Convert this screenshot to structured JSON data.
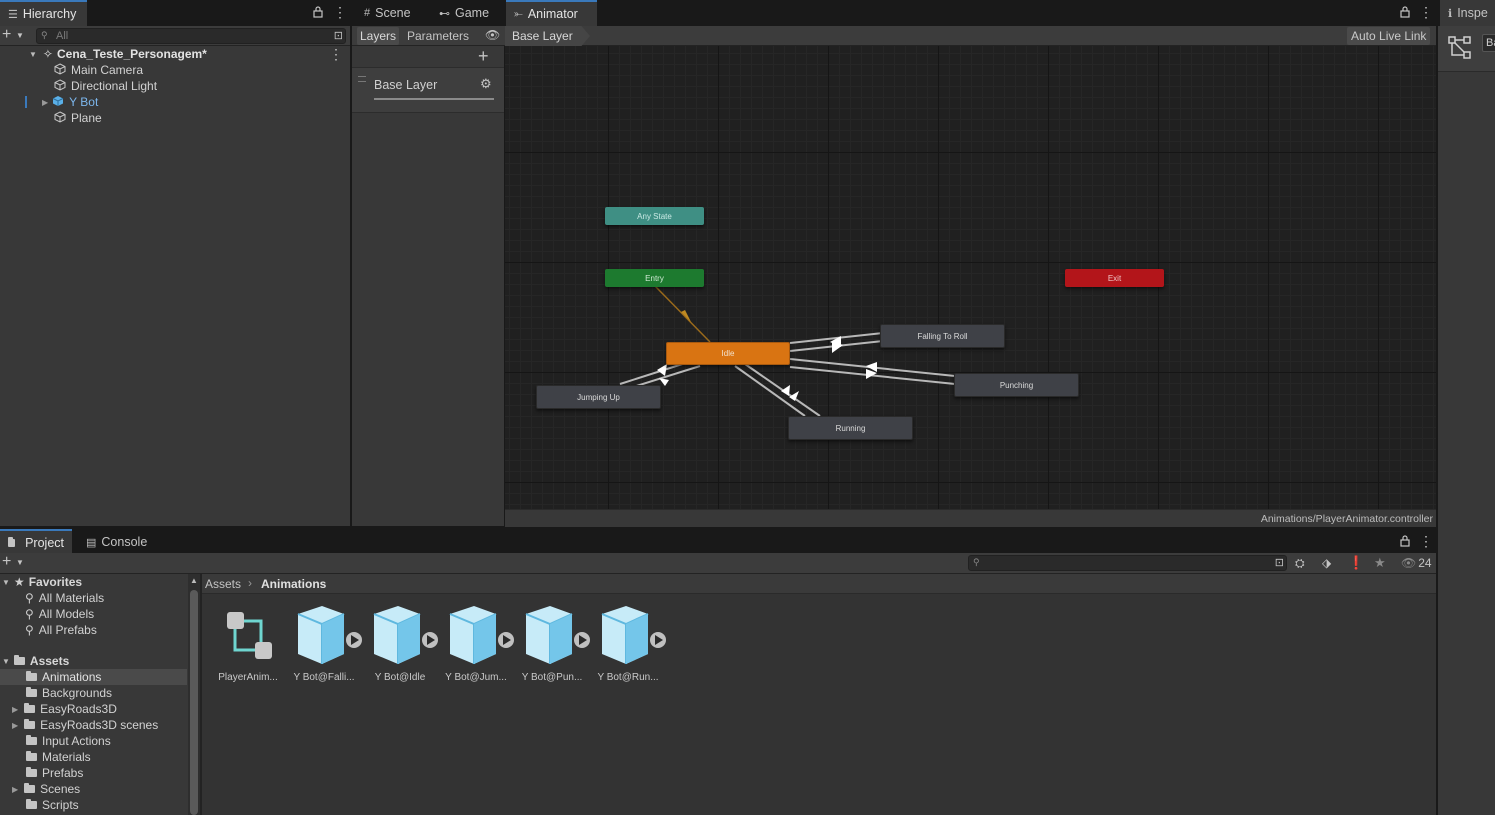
{
  "hierarchy": {
    "tab_label": "Hierarchy",
    "search_placeholder": "All",
    "scene_name": "Cena_Teste_Personagem*",
    "objects": [
      "Main Camera",
      "Directional Light",
      "Y Bot",
      "Plane"
    ]
  },
  "center_tabs": {
    "scene": "Scene",
    "game": "Game",
    "animator": "Animator"
  },
  "animator": {
    "layers_tab": "Layers",
    "parameters_tab": "Parameters",
    "breadcrumb": "Base Layer",
    "auto_live_link": "Auto Live Link",
    "layer_name": "Base Layer",
    "footer_path": "Animations/PlayerAnimator.controller",
    "states": {
      "any_state": "Any State",
      "entry": "Entry",
      "exit": "Exit",
      "idle": "Idle",
      "falling_to_roll": "Falling To Roll",
      "punching": "Punching",
      "jumping_up": "Jumping Up",
      "running": "Running"
    }
  },
  "inspector": {
    "tab_label": "Inspe",
    "field_value": "Ba"
  },
  "bottom_tabs": {
    "project": "Project",
    "console": "Console"
  },
  "project": {
    "favorites_label": "Favorites",
    "favorites": [
      "All Materials",
      "All Models",
      "All Prefabs"
    ],
    "assets_label": "Assets",
    "folders": [
      "Animations",
      "Backgrounds",
      "EasyRoads3D",
      "EasyRoads3D scenes",
      "Input Actions",
      "Materials",
      "Prefabs",
      "Scenes",
      "Scripts"
    ],
    "breadcrumb_root": "Assets",
    "breadcrumb_current": "Animations",
    "visible_count": "24",
    "assets": [
      "PlayerAnim...",
      "Y Bot@Falli...",
      "Y Bot@Idle",
      "Y Bot@Jum...",
      "Y Bot@Pun...",
      "Y Bot@Run..."
    ]
  },
  "colors": {
    "accent": "#3a79bb",
    "default_state": "#d97412",
    "any_state": "#3f8f84",
    "entry": "#1d7a2f",
    "exit": "#b3151a"
  }
}
